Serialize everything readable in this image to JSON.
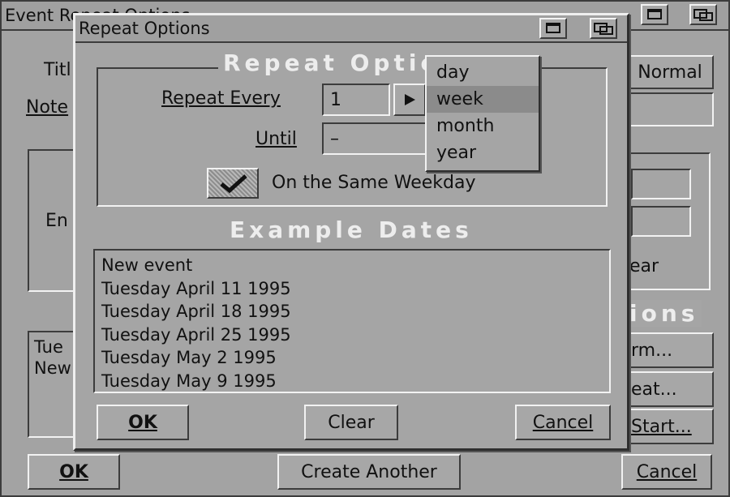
{
  "back_window": {
    "title": "Event Repeat Options",
    "title_label": "Titl",
    "note_label": "Note",
    "normal_button": "Normal",
    "end_label": "En",
    "year_button": "ear",
    "options_heading": "ions",
    "list_lines": [
      "Tue",
      "New"
    ],
    "alarm_button": "rm...",
    "repeat_button": "eat...",
    "start_button": "Start...",
    "ok_button": "OK",
    "create_another_button": "Create Another",
    "cancel_button": "Cancel"
  },
  "dialog": {
    "title": "Repeat Options",
    "section_title": "Repeat Options",
    "repeat_every_label": "Repeat Every",
    "repeat_every_value": "1",
    "until_label": "Until",
    "until_value": "–",
    "same_weekday_label": "On the Same Weekday",
    "same_weekday_checked": true,
    "example_heading": "Example Dates",
    "example_dates": [
      "New event",
      "Tuesday April 11 1995",
      "Tuesday April 18 1995",
      "Tuesday April 25 1995",
      "Tuesday May 2 1995",
      "Tuesday May 9 1995"
    ],
    "ok_button": "OK",
    "clear_button": "Clear",
    "cancel_button": "Cancel"
  },
  "unit_menu": {
    "options": [
      "day",
      "week",
      "month",
      "year"
    ],
    "selected": "week"
  }
}
